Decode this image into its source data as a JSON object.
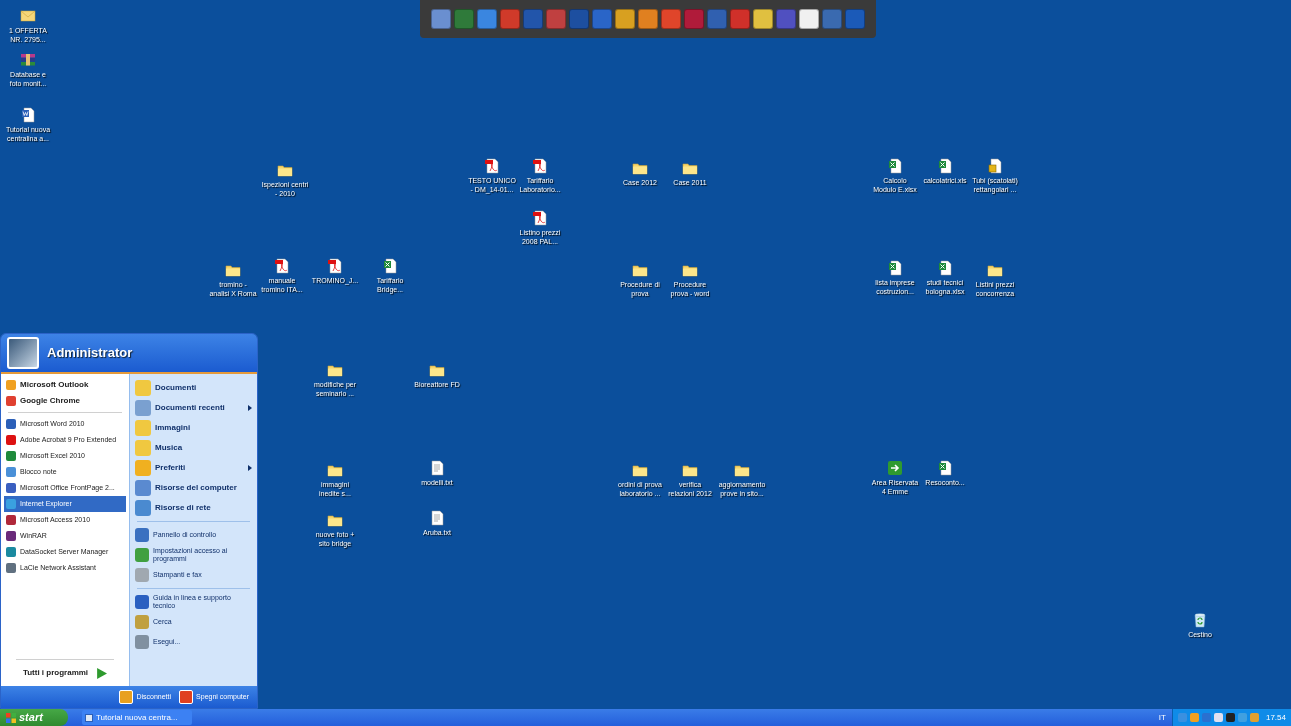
{
  "desktop_icons": [
    {
      "kind": "mail",
      "label": "1 OFFERTA NR. 2795..."
    },
    {
      "kind": "archive",
      "label": "Database e foto monit..."
    },
    {
      "kind": "word",
      "label": "Tutorial nuova centralina a..."
    },
    {
      "kind": "folder",
      "label": "Ispezioni centri - 2010"
    },
    {
      "kind": "pdf",
      "label": "TESTO UNICO - DM_14-01..."
    },
    {
      "kind": "pdf",
      "label": "Tariffario Laboratorio..."
    },
    {
      "kind": "pdf",
      "label": "Listino prezzi 2008 PAL..."
    },
    {
      "kind": "folder",
      "label": "Case 2012"
    },
    {
      "kind": "folder",
      "label": "Case 2011"
    },
    {
      "kind": "excel",
      "label": "Calcolo Modulo E.xlsx"
    },
    {
      "kind": "excel",
      "label": "calcolatrici.xls"
    },
    {
      "kind": "access",
      "label": "Tubi (scatolati) rettangolari ..."
    },
    {
      "kind": "folder",
      "label": "tromino - analisi X Roma"
    },
    {
      "kind": "pdf",
      "label": "manuale tromino ITA..."
    },
    {
      "kind": "pdf",
      "label": "TROMINO_J..."
    },
    {
      "kind": "excel",
      "label": "Tariffario Bridge..."
    },
    {
      "kind": "folder",
      "label": "Procedure di prova"
    },
    {
      "kind": "folder",
      "label": "Procedure prova - word"
    },
    {
      "kind": "excel",
      "label": "lista imprese costruzion..."
    },
    {
      "kind": "excel",
      "label": "studi tecnici bologna.xlsx"
    },
    {
      "kind": "folder",
      "label": "Listini prezzi concorrenza"
    },
    {
      "kind": "folder",
      "label": "modifiche per seminario ..."
    },
    {
      "kind": "folder",
      "label": "Bioreattore FD"
    },
    {
      "kind": "folder",
      "label": "immagini inedite s..."
    },
    {
      "kind": "text",
      "label": "modelli.txt"
    },
    {
      "kind": "folder",
      "label": "ordini di prova laboratorio ..."
    },
    {
      "kind": "folder",
      "label": "verifica relazioni 2012"
    },
    {
      "kind": "folder",
      "label": "aggiornamento prove in sito..."
    },
    {
      "kind": "shortcut",
      "label": "Area Riservata 4 Emme"
    },
    {
      "kind": "excel",
      "label": "Resoconto..."
    },
    {
      "kind": "folder",
      "label": "nuove foto + sito bridge"
    },
    {
      "kind": "text",
      "label": "Aruba.txt"
    },
    {
      "kind": "recycle",
      "label": "Cestino"
    }
  ],
  "start_menu": {
    "user": "Administrator",
    "pinned": [
      {
        "kind": "outlook",
        "label": "Microsoft Outlook",
        "selected": false
      },
      {
        "kind": "chrome",
        "label": "Google Chrome",
        "selected": false
      }
    ],
    "recent": [
      {
        "kind": "word",
        "label": "Microsoft Word 2010",
        "selected": false
      },
      {
        "kind": "acrobat",
        "label": "Adobe Acrobat 9 Pro Extended",
        "selected": false
      },
      {
        "kind": "excel",
        "label": "Microsoft Excel 2010",
        "selected": false
      },
      {
        "kind": "notepad",
        "label": "Blocco note",
        "selected": false
      },
      {
        "kind": "frontpage",
        "label": "Microsoft Office FrontPage 2...",
        "selected": false
      },
      {
        "kind": "ie",
        "label": "Internet Explorer",
        "selected": true
      },
      {
        "kind": "access",
        "label": "Microsoft Access 2010",
        "selected": false
      },
      {
        "kind": "winrar",
        "label": "WinRAR",
        "selected": false
      },
      {
        "kind": "datasocket",
        "label": "DataSocket Server Manager",
        "selected": false
      },
      {
        "kind": "network",
        "label": "LaCie Network Assistant",
        "selected": false
      }
    ],
    "all_programs": "Tutti i programmi",
    "place_groups": [
      [
        {
          "kind": "documents",
          "label": "Documenti",
          "submenu": false
        },
        {
          "kind": "recent",
          "label": "Documenti recenti",
          "submenu": true
        },
        {
          "kind": "pictures",
          "label": "Immagini",
          "submenu": false
        },
        {
          "kind": "music",
          "label": "Musica",
          "submenu": false
        },
        {
          "kind": "favorites",
          "label": "Preferiti",
          "submenu": true
        },
        {
          "kind": "computer",
          "label": "Risorse del computer",
          "submenu": false
        },
        {
          "kind": "network",
          "label": "Risorse di rete",
          "submenu": false
        }
      ],
      [
        {
          "kind": "control",
          "label": "Pannello di controllo",
          "submenu": false
        },
        {
          "kind": "programs",
          "label": "Impostazioni accesso ai programmi",
          "submenu": false
        },
        {
          "kind": "printer",
          "label": "Stampanti e fax",
          "submenu": false
        }
      ],
      [
        {
          "kind": "help",
          "label": "Guida in linea e supporto tecnico",
          "submenu": false
        },
        {
          "kind": "search",
          "label": "Cerca",
          "submenu": false
        },
        {
          "kind": "run",
          "label": "Esegui...",
          "submenu": false
        }
      ]
    ],
    "footer_buttons": [
      {
        "kind": "logoff",
        "label": "Disconnetti"
      },
      {
        "kind": "shutdown",
        "label": "Spegni computer"
      }
    ]
  },
  "taskbar": {
    "start": "start",
    "tasks": [
      {
        "label": "Tutorial nuova centra...",
        "selected": false
      }
    ],
    "language": "IT",
    "clock": "17.54"
  }
}
